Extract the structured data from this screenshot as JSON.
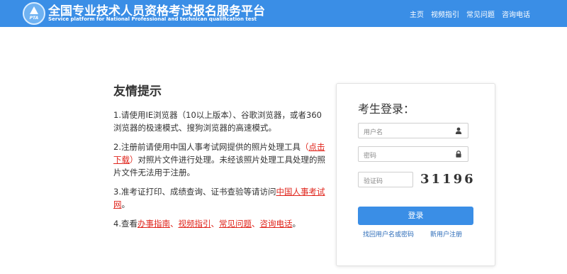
{
  "header": {
    "logo_text": "PTA",
    "title_cn": "全国专业技术人员资格考试报名服务平台",
    "title_en": "Service platform for National Professional and technican qualification test",
    "nav": [
      "主页",
      "视频指引",
      "常见问题",
      "咨询电话"
    ]
  },
  "tips": {
    "heading": "友情提示",
    "tip1": "1.请使用IE浏览器（10以上版本）、谷歌浏览器，或者360浏览器的极速模式、搜狗浏览器的高速模式。",
    "tip2_a": "2.注册前请使用中国人事考试网提供的照片处理工具",
    "tip2_paren_open": "（",
    "tip2_link": "点击下载",
    "tip2_paren_close": "）",
    "tip2_b": "对照片文件进行处理。未经该照片处理工具处理的照片文件无法用于注册。",
    "tip3_a": "3.准考证打印、成绩查询、证书查验等请访问",
    "tip3_link": "中国人事考试网",
    "tip3_end": "。",
    "tip4_a": "4.查看",
    "tip4_links": [
      "办事指南",
      "视频指引",
      "常见问题",
      "咨询电话"
    ],
    "tip4_sep": "、",
    "tip4_end": "。"
  },
  "login": {
    "title": "考生登录：",
    "username_placeholder": "用户名",
    "password_placeholder": "密码",
    "captcha_placeholder": "验证码",
    "captcha_text": "31196",
    "submit_label": "登录",
    "forgot_link": "找回用户名或密码",
    "register_link": "新用户注册"
  },
  "colors": {
    "header_bg": "#3a8ee6",
    "button_bg": "#3a8ee6",
    "link_red": "#e0251c",
    "link_blue": "#2b6bb8"
  }
}
